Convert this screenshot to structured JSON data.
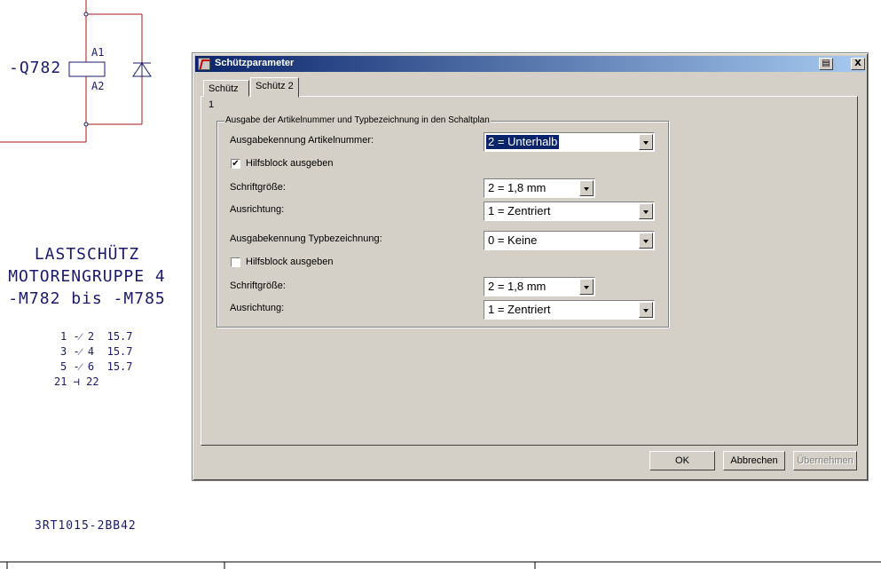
{
  "schematic": {
    "device_tag": "-Q782",
    "coil_a1": "A1",
    "coil_a2": "A2",
    "title_lines": [
      "LASTSCHÜTZ",
      "MOTORENGRUPPE 4",
      "-M782 bis -M785"
    ],
    "contacts": [
      {
        "from": "1",
        "to": "2",
        "ref": "15.7"
      },
      {
        "from": "3",
        "to": "4",
        "ref": "15.7"
      },
      {
        "from": "5",
        "to": "6",
        "ref": "15.7"
      },
      {
        "from": "21",
        "to": "22",
        "ref": ""
      }
    ],
    "order_number": "3RT1015-2BB42"
  },
  "dialog": {
    "title": "Schützparameter",
    "print_icon": "printer-icon",
    "close_label": "X",
    "tabs": [
      {
        "label": "Schütz 1",
        "active": false
      },
      {
        "label": "Schütz 2",
        "active": true
      }
    ],
    "group_title": "Ausgabe der Artikelnummer und Typbezeichnung in den Schaltplan",
    "article": {
      "output_label": "Ausgabekennung Artikelnummer:",
      "output_value": "2 = Unterhalb",
      "aux_label": "Hilfsblock ausgeben",
      "aux_checked": true,
      "font_label": "Schriftgröße:",
      "font_value": "2 = 1,8 mm",
      "align_label": "Ausrichtung:",
      "align_value": "1 = Zentriert"
    },
    "type": {
      "output_label": "Ausgabekennung Typbezeichnung:",
      "output_value": "0 = Keine",
      "aux_label": "Hilfsblock ausgeben",
      "aux_checked": false,
      "font_label": "Schriftgröße:",
      "font_value": "2 = 1,8 mm",
      "align_label": "Ausrichtung:",
      "align_value": "1 = Zentriert"
    },
    "buttons": {
      "ok": "OK",
      "cancel": "Abbrechen",
      "apply": "Übernehmen"
    },
    "colors": {
      "titlebar_start": "#0a246a",
      "titlebar_end": "#a6caf0",
      "face": "#d4d0c8",
      "selection": "#0a246a",
      "schematic_wire": "#a01818",
      "schematic_text": "#1a1a6a"
    }
  }
}
